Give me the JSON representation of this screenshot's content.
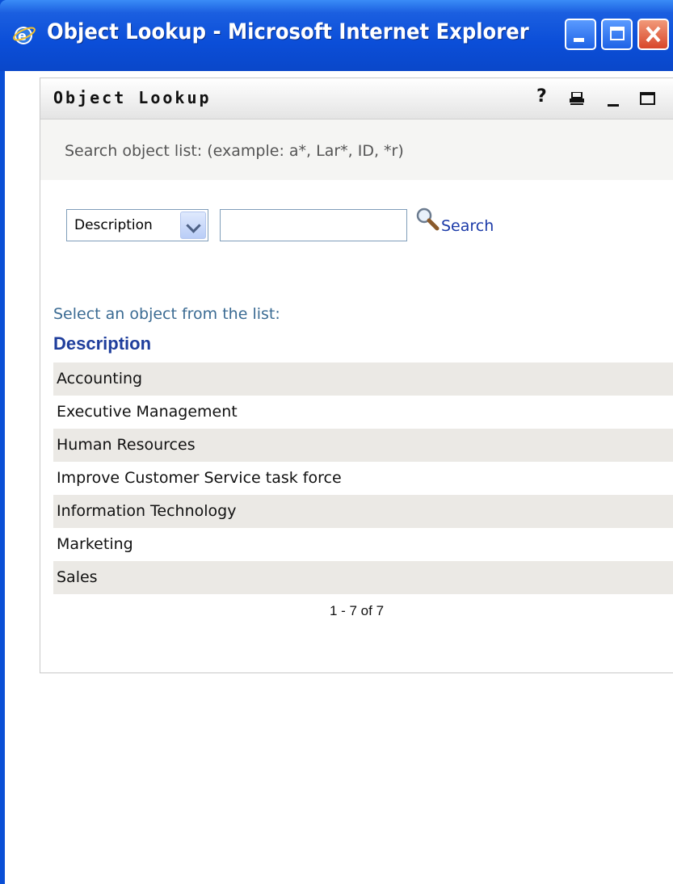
{
  "window": {
    "title": "Object Lookup - Microsoft Internet Explorer"
  },
  "portlet": {
    "title": "Object Lookup",
    "help_glyph": "?",
    "icons": [
      "help-icon",
      "print-icon",
      "minimize-icon",
      "maximize-icon"
    ]
  },
  "search": {
    "hint": "Search object list: (example: a*, Lar*, ID, *r)",
    "field_selected": "Description",
    "input_value": "",
    "button_label": "Search"
  },
  "list": {
    "caption": "Select an object from the list:",
    "column_header": "Description",
    "rows": [
      "Accounting",
      "Executive Management",
      "Human Resources",
      "Improve Customer Service task force",
      "Information Technology",
      "Marketing",
      "Sales"
    ],
    "pager": "1 - 7 of 7"
  },
  "colors": {
    "titlebar": "#0a4fd6",
    "link": "#1b3aa8",
    "header": "#1f3e9c",
    "row_alt": "#ebe9e5"
  }
}
